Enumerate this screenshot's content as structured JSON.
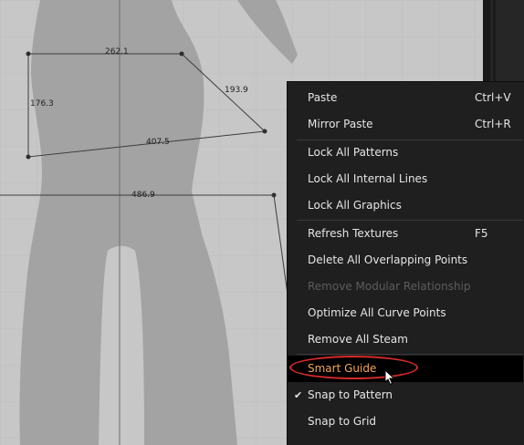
{
  "canvas": {
    "measurements": [
      {
        "id": "top",
        "text": "262.1"
      },
      {
        "id": "left",
        "text": "176.3"
      },
      {
        "id": "diag",
        "text": "193.9"
      },
      {
        "id": "bottom",
        "text": "407.5"
      },
      {
        "id": "long",
        "text": "486.9"
      }
    ]
  },
  "context_menu": {
    "items": [
      {
        "label": "Paste",
        "shortcut": "Ctrl+V"
      },
      {
        "label": "Mirror Paste",
        "shortcut": "Ctrl+R"
      },
      {
        "label": "Lock All Patterns"
      },
      {
        "label": "Lock All Internal Lines"
      },
      {
        "label": "Lock All Graphics"
      },
      {
        "label": "Refresh Textures",
        "shortcut": "F5"
      },
      {
        "label": "Delete All Overlapping Points"
      },
      {
        "label": "Remove Modular Relationship",
        "disabled": true
      },
      {
        "label": "Optimize All Curve Points"
      },
      {
        "label": "Remove All Steam"
      },
      {
        "label": "Smart Guide",
        "highlighted": true
      },
      {
        "label": "Snap to Pattern",
        "checked": true
      },
      {
        "label": "Snap to Grid"
      }
    ],
    "check_glyph": "✔",
    "highlight_color": "#f1a45c",
    "annotation_color": "#d42a2a"
  }
}
